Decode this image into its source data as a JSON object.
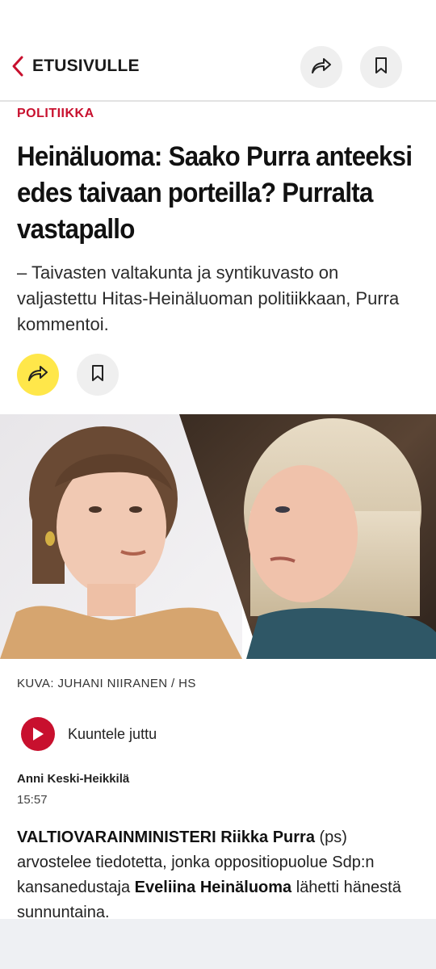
{
  "header": {
    "back_label": "ETUSIVULLE",
    "icons": {
      "back": "chevron-left-icon",
      "share": "share-arrow-icon",
      "bookmark": "bookmark-icon"
    },
    "accent_color": "#c8102e"
  },
  "article": {
    "section": "POLITIIKKA",
    "headline": "Heinäluoma: Saako Purra anteeksi edes taivaan porteilla? Purralta vastapallo",
    "lead": "– Taivasten valtakunta ja syntikuvasto on valjastettu Hitas-Heinäluoman politiikkaan, Purra kommentoi.",
    "share_button_color": "#ffe74a",
    "photo_credit": "KUVA: JUHANI NIIRANEN / HS",
    "listen_label": "Kuuntele juttu",
    "author": "Anni Keski-Heikkilä",
    "time": "15:57",
    "body": {
      "part1": "VALTIOVARAINMINISTERI",
      "part2": " ",
      "part3": "Riikka Purra",
      "part4": " (ps) arvostelee tiedotetta, jonka oppositiopuolue Sdp:n kansanedustaja ",
      "part5": "Eveliina Heinäluoma",
      "part6": " lähetti hänestä sunnuntaina."
    }
  }
}
